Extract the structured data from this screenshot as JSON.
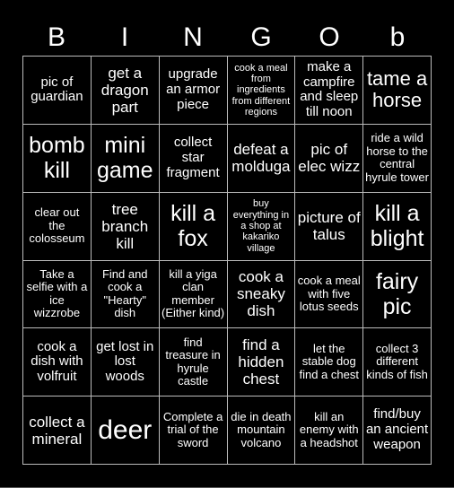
{
  "header": [
    "B",
    "I",
    "N",
    "G",
    "O",
    "b"
  ],
  "cells": [
    "pic of guardian",
    "get a dragon part",
    "upgrade an armor piece",
    "cook a meal from ingredients from different regions",
    "make a campfire and sleep till noon",
    "tame a horse",
    "bomb kill",
    "mini game",
    "collect star fragment",
    "defeat a molduga",
    "pic of elec wizz",
    "ride a wild horse to the central hyrule tower",
    "clear out the colosseum",
    "tree branch kill",
    "kill a fox",
    "buy everything in a shop at kakariko village",
    "picture of talus",
    "kill a blight",
    "Take a selfie with a ice wizzrobe",
    "Find and cook a \"Hearty\" dish",
    "kill a yiga clan member (Either kind)",
    "cook a sneaky dish",
    "cook a meal with five lotus seeds",
    "fairy pic",
    "cook a dish with volfruit",
    "get lost in lost woods",
    "find treasure in hyrule castle",
    "find a hidden chest",
    "let the stable dog find a chest",
    "collect 3 different kinds of fish",
    "collect a mineral",
    "deer",
    "Complete a trial of the sword",
    "die in death mountain volcano",
    "kill an enemy with a headshot",
    "find/buy an ancient weapon"
  ]
}
